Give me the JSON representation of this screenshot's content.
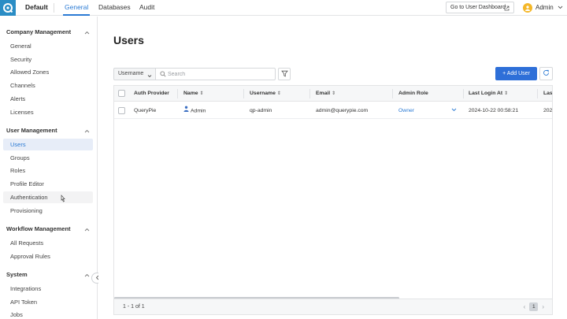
{
  "app": {
    "brand_color": "#2a8dc5",
    "accent": "#2e6fd8"
  },
  "topbar": {
    "project": "Default",
    "tabs": [
      {
        "label": "General",
        "active": true
      },
      {
        "label": "Databases",
        "active": false
      },
      {
        "label": "Audit",
        "active": false
      }
    ],
    "dashboard_button": "Go to User Dashboard",
    "user_name": "Admin"
  },
  "sidebar": {
    "groups": [
      {
        "title": "Company Management",
        "items": [
          "General",
          "Security",
          "Allowed Zones",
          "Channels",
          "Alerts",
          "Licenses"
        ]
      },
      {
        "title": "User Management",
        "items": [
          "Users",
          "Groups",
          "Roles",
          "Profile Editor",
          "Authentication",
          "Provisioning"
        ]
      },
      {
        "title": "Workflow Management",
        "items": [
          "All Requests",
          "Approval Rules"
        ]
      },
      {
        "title": "System",
        "items": [
          "Integrations",
          "API Token",
          "Jobs"
        ]
      }
    ],
    "selected_item": "Users",
    "hovered_item": "Authentication"
  },
  "main": {
    "title": "Users",
    "filter": {
      "selected": "Username",
      "search_placeholder": "Search",
      "search_value": ""
    },
    "add_button": "+ Add User",
    "table": {
      "columns": [
        "Auth Provider",
        "Name",
        "Username",
        "Email",
        "Admin Role",
        "Last Login At",
        "Last"
      ],
      "rows": [
        {
          "auth_provider": "QueryPie",
          "name": "Admin",
          "username": "qp-admin",
          "email": "admin@querypie.com",
          "admin_role": "Owner",
          "last_login_at": "2024-10-22 00:58:21",
          "last_partial": "202"
        }
      ]
    },
    "pagination": {
      "summary": "1 - 1 of 1",
      "current_page": "1"
    }
  }
}
